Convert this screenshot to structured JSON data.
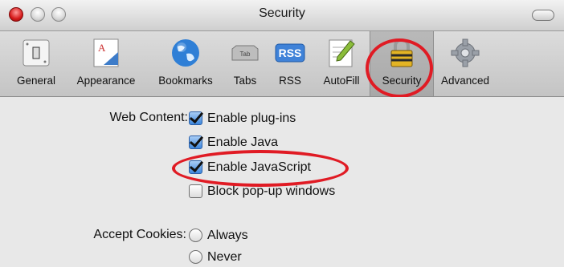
{
  "window": {
    "title": "Security"
  },
  "toolbar": {
    "items": [
      {
        "label": "General",
        "icon": "general-icon"
      },
      {
        "label": "Appearance",
        "icon": "appearance-icon"
      },
      {
        "label": "Bookmarks",
        "icon": "globe-icon"
      },
      {
        "label": "Tabs",
        "icon": "tabs-icon"
      },
      {
        "label": "RSS",
        "icon": "rss-icon"
      },
      {
        "label": "AutoFill",
        "icon": "autofill-icon"
      },
      {
        "label": "Security",
        "icon": "lock-icon",
        "selected": true
      },
      {
        "label": "Advanced",
        "icon": "gear-icon"
      }
    ],
    "tabs_icon_text": "Tab",
    "rss_icon_text": "RSS"
  },
  "web_content": {
    "label": "Web Content:",
    "options": [
      {
        "label": "Enable plug-ins",
        "checked": true
      },
      {
        "label": "Enable Java",
        "checked": true
      },
      {
        "label": "Enable JavaScript",
        "checked": true
      },
      {
        "label": "Block pop-up windows",
        "checked": false
      }
    ]
  },
  "cookies": {
    "label": "Accept Cookies:",
    "options": [
      {
        "label": "Always",
        "selected": false
      },
      {
        "label": "Never",
        "selected": false
      }
    ]
  },
  "colors": {
    "highlight_ring": "#e01b24",
    "checkbox_accent": "#3d87dd"
  }
}
